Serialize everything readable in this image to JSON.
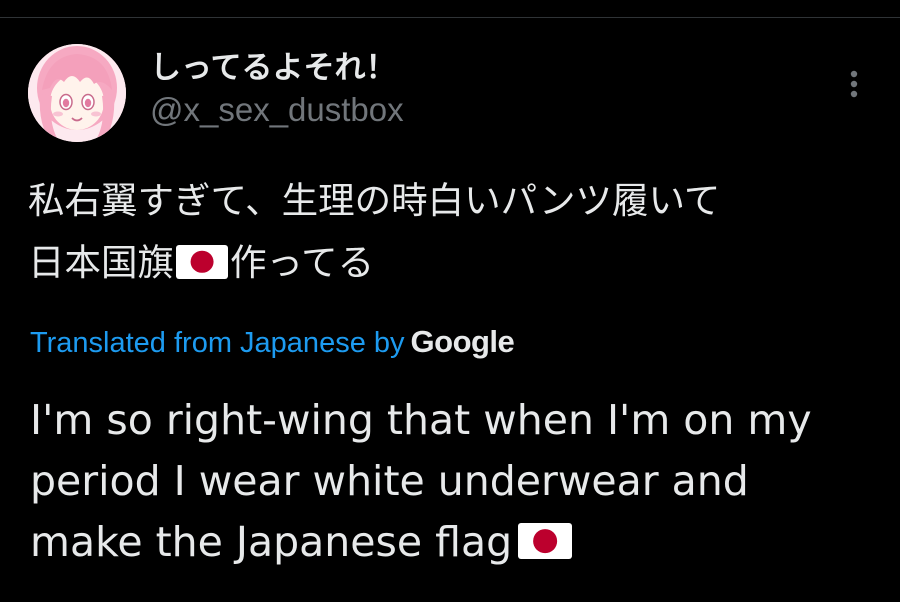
{
  "author": {
    "display_name": "しってるよそれ！",
    "handle": "@x_sex_dustbox",
    "avatar_icon": "anime-avatar-icon"
  },
  "more_icon": "more-options-icon",
  "post": {
    "text_line_1": "私右翼すぎて、生理の時白いパンツ履いて",
    "text_line_2_before_flag": "日本国旗",
    "flag_emoji": "flag-japan-icon",
    "text_line_2_after_flag": "作ってる"
  },
  "translation": {
    "label": "Translated from Japanese by",
    "provider": "Google",
    "line_1": "I'm so right-wing that when I'm on my",
    "line_2": "period I wear white underwear and",
    "line_3": "make the Japanese flag"
  },
  "colors": {
    "background": "#000000",
    "text_primary": "#e7e9ea",
    "text_secondary": "#71767b",
    "link": "#1d9bf0",
    "flag_red": "#bc002d"
  }
}
